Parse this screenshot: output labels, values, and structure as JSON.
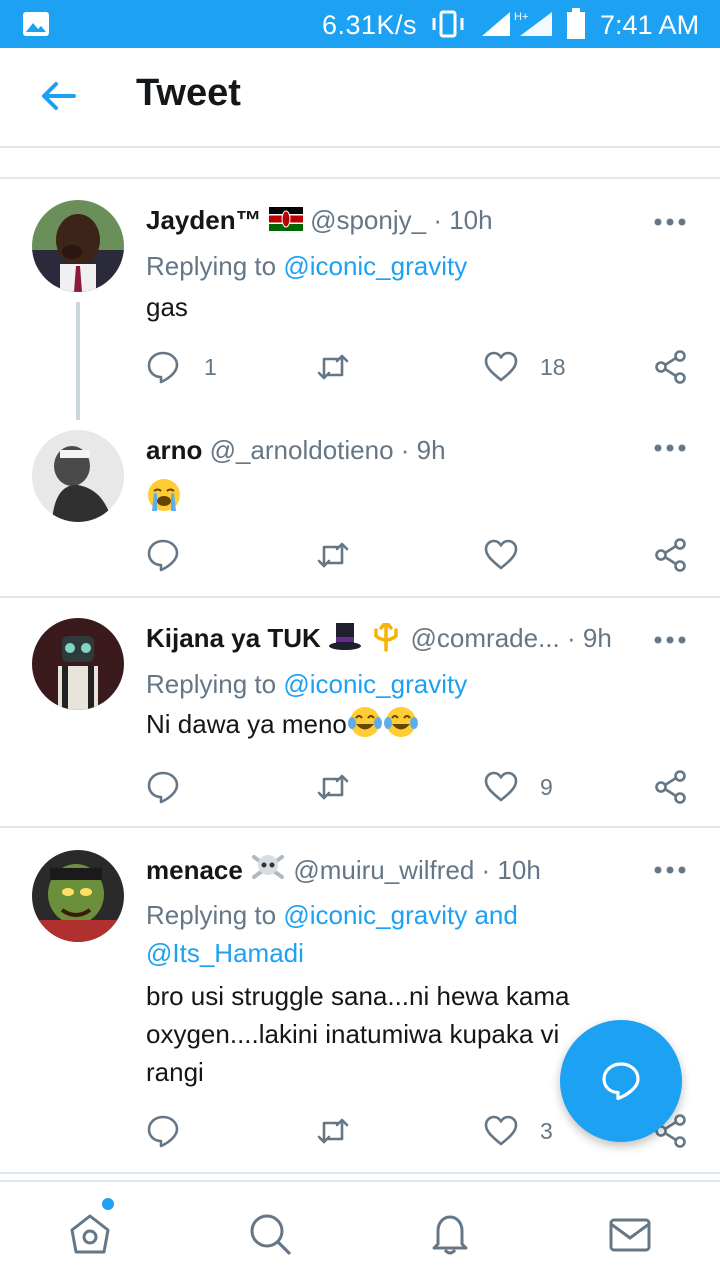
{
  "status_bar": {
    "speed": "6.31K/s",
    "network": "H+",
    "time": "7:41 AM",
    "icons": [
      "gallery-icon",
      "vibrate-icon",
      "signal-icon",
      "battery-icon"
    ]
  },
  "header": {
    "title": "Tweet",
    "back_icon": "arrow-left-icon"
  },
  "tweets": [
    {
      "name": "Jayden™",
      "flag": "kenya-flag-emoji",
      "handle": "@sponjy_",
      "time": "· 10h",
      "replying_prefix": "Replying to ",
      "replying_to": "@iconic_gravity",
      "replying_to_2": "",
      "text": "gas",
      "reply_count": "1",
      "retweet_count": "",
      "like_count": "18"
    },
    {
      "name": "arno",
      "handle": "@_arnoldotieno",
      "time": "· 9h",
      "text_emoji": "loudly-crying-face-emoji",
      "reply_count": "",
      "retweet_count": "",
      "like_count": ""
    },
    {
      "name": "Kijana ya TUK",
      "name_emojis": [
        "top-hat-emoji",
        "trident-emblem-emoji"
      ],
      "handle": "@comrade...",
      "time": "· 9h",
      "replying_prefix": "Replying to ",
      "replying_to": "@iconic_gravity",
      "text": "Ni dawa ya meno",
      "text_emojis": [
        "tears-of-joy-emoji",
        "tears-of-joy-emoji"
      ],
      "reply_count": "",
      "retweet_count": "",
      "like_count": "9"
    },
    {
      "name": "menace",
      "name_emoji": "skull-crossbones-emoji",
      "handle": "@muiru_wilfred",
      "time": "· 10h",
      "replying_prefix": "Replying to ",
      "replying_to": "@iconic_gravity and",
      "replying_to_2": "@Its_Hamadi",
      "text": "bro usi struggle sana...ni hewa kama oxygen....lakini inatumiwa kupaka vi rangi",
      "reply_count": "",
      "retweet_count": "",
      "like_count": "3"
    }
  ],
  "fab": {
    "icon": "compose-reply-icon"
  },
  "bottom_nav": {
    "items": [
      "home-icon",
      "search-icon",
      "notifications-icon",
      "messages-icon"
    ],
    "home_has_dot": true
  },
  "colors": {
    "accent": "#1da1f2",
    "text": "#14171a",
    "muted": "#657786",
    "divider": "#e1e8ed"
  }
}
